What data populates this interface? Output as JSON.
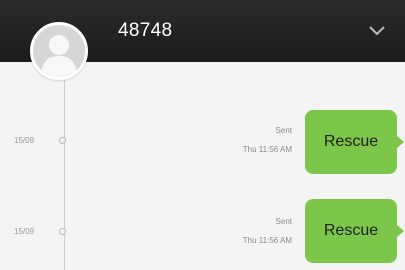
{
  "header": {
    "title": "48748",
    "collapse_icon": "chevron-down-icon"
  },
  "contact": {
    "avatar_icon": "default-avatar-icon"
  },
  "messages": [
    {
      "date": "15/09",
      "status": "Sent",
      "time": "Thu 11:56 AM",
      "text": "Rescue"
    },
    {
      "date": "15/09",
      "status": "Sent",
      "time": "Thu 11:56 AM",
      "text": "Rescue"
    }
  ],
  "colors": {
    "header_bg": "#222222",
    "bubble_bg": "#7cc64a",
    "page_bg": "#f4f4f4"
  }
}
